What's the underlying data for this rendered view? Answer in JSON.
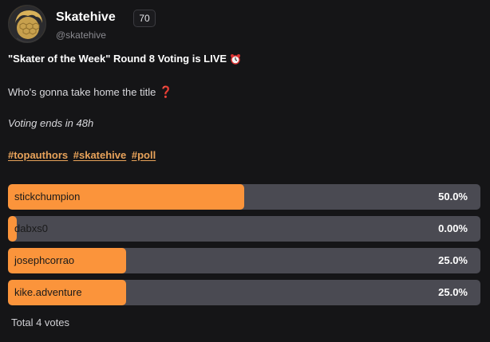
{
  "author": {
    "name": "Skatehive",
    "reputation": "70",
    "handle": "@skatehive"
  },
  "post": {
    "title": "\"Skater of the Week\" Round 8 Voting is LIVE",
    "title_icon": "alarm-clock-icon",
    "question": "Who's gonna take home the title",
    "question_icon": "red-question-mark-icon",
    "voting_ends": "Voting ends in 48h",
    "tags": [
      "#topauthors",
      "#skatehive",
      "#poll"
    ]
  },
  "poll": {
    "options": [
      {
        "label": "stickchumpion",
        "percent_text": "50.0%",
        "fraction": 0.5
      },
      {
        "label": "dabxs0",
        "percent_text": "0.00%",
        "fraction": 0.0
      },
      {
        "label": "josephcorrao",
        "percent_text": "25.0%",
        "fraction": 0.25
      },
      {
        "label": "kike.adventure",
        "percent_text": "25.0%",
        "fraction": 0.25
      }
    ],
    "total": "Total 4 votes"
  },
  "colors": {
    "background": "#151517",
    "accent": "#fb943b",
    "bar_track": "#4a4a52",
    "tag": "#e7a25a"
  }
}
